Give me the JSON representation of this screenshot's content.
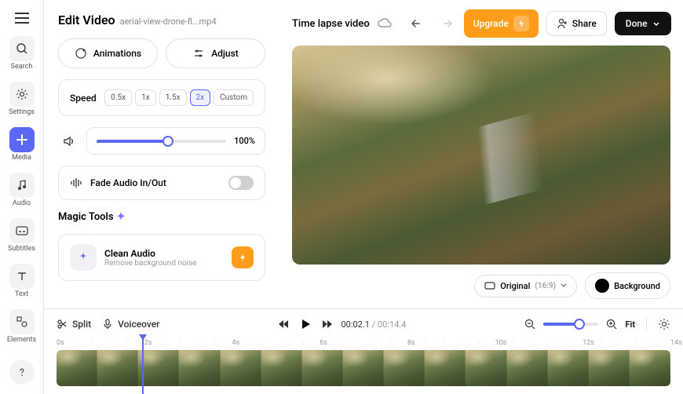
{
  "sidebar": {
    "items": [
      {
        "label": "Search",
        "icon": "search"
      },
      {
        "label": "Settings",
        "icon": "settings"
      },
      {
        "label": "Media",
        "icon": "plus"
      },
      {
        "label": "Audio",
        "icon": "music"
      },
      {
        "label": "Subtitles",
        "icon": "subtitles"
      },
      {
        "label": "Text",
        "icon": "text"
      },
      {
        "label": "Elements",
        "icon": "elements"
      }
    ]
  },
  "panel": {
    "title": "Edit Video",
    "filename": "aerial-view-drone-fl...mp4",
    "animations_label": "Animations",
    "adjust_label": "Adjust",
    "speed_label": "Speed",
    "speed_options": [
      "0.5x",
      "1x",
      "1.5x",
      "2x",
      "Custom"
    ],
    "speed_selected": "2x",
    "volume_value": "100%",
    "volume_pct": 55,
    "fade_label": "Fade Audio In/Out",
    "magic_title": "Magic Tools",
    "clean_audio_title": "Clean Audio",
    "clean_audio_sub": "Remove background noise"
  },
  "header": {
    "project_name": "Time lapse video",
    "upgrade_label": "Upgrade",
    "share_label": "Share",
    "done_label": "Done"
  },
  "preview_controls": {
    "aspect_label": "Original",
    "aspect_ratio": "(16:9)",
    "background_label": "Background"
  },
  "timeline": {
    "split_label": "Split",
    "voiceover_label": "Voiceover",
    "current_time": "00:02.1",
    "duration": "00:14.4",
    "fit_label": "Fit",
    "zoom_pct": 65,
    "ruler_marks": [
      "0s",
      "2s",
      "4s",
      "6s",
      "8s",
      "10s",
      "12s",
      "14s"
    ],
    "playhead_pct": 14,
    "thumb_count": 15
  }
}
